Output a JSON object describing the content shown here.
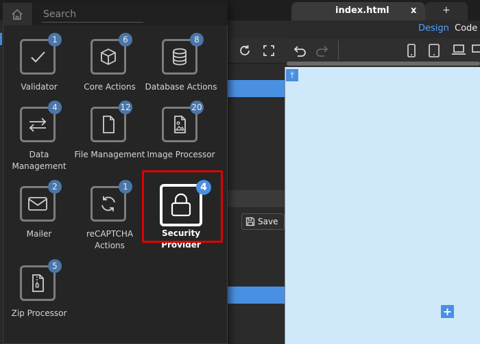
{
  "tabs": {
    "active_title": "index.html",
    "close_label": "x",
    "new_tab_label": "+"
  },
  "view_toggle": {
    "design_label": "Design",
    "code_label": "Code"
  },
  "save_button": {
    "label": "Save"
  },
  "search": {
    "placeholder": "Search"
  },
  "actions": [
    {
      "label": "Validator",
      "badge": "1",
      "icon": "check-icon"
    },
    {
      "label": "Core Actions",
      "badge": "6",
      "icon": "cube-icon"
    },
    {
      "label": "Database Actions",
      "badge": "8",
      "icon": "database-icon"
    },
    {
      "label": "Data Management",
      "badge": "4",
      "icon": "transfer-arrows-icon"
    },
    {
      "label": "File Management",
      "badge": "12",
      "icon": "file-icon"
    },
    {
      "label": "Image Processor",
      "badge": "20",
      "icon": "image-file-icon"
    },
    {
      "label": "Mailer",
      "badge": "2",
      "icon": "envelope-icon"
    },
    {
      "label": "reCAPTCHA Actions",
      "badge": "1",
      "icon": "refresh-icon"
    },
    {
      "label": "Security Provider",
      "badge": "4",
      "icon": "lock-icon",
      "selected": true
    },
    {
      "label": "Zip Processor",
      "badge": "5",
      "icon": "zip-file-icon"
    }
  ],
  "colors": {
    "accent": "#4a90e2",
    "highlight": "#e10000",
    "canvas": "#cfe9fb"
  }
}
